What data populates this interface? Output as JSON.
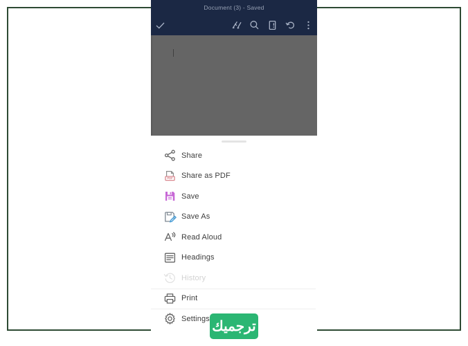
{
  "frame": {
    "border_color": "#2d4a33"
  },
  "titlebar": {
    "title": "Document (3) - Saved",
    "background": "#1b2844",
    "text_color": "#97a1b4"
  },
  "toolbar": {
    "items": [
      {
        "name": "done-check-icon",
        "label": "Done"
      },
      {
        "name": "ink-pen-icon",
        "label": "Ink"
      },
      {
        "name": "search-icon",
        "label": "Search"
      },
      {
        "name": "mobile-view-icon",
        "label": "Mobile view"
      },
      {
        "name": "undo-icon",
        "label": "Undo"
      },
      {
        "name": "overflow-menu-icon",
        "label": "More options"
      }
    ],
    "icon_color": "#a9b3c6"
  },
  "document": {
    "scrim_color": "#656565",
    "caret_visible": true,
    "drag_handle_color": "#e4e4e4"
  },
  "menu": {
    "items": [
      {
        "label": "Share",
        "icon": "share-icon",
        "icon_color": "#636363",
        "disabled": false,
        "divider_above": false
      },
      {
        "label": "Share as PDF",
        "icon": "share-as-pdf-icon",
        "icon_color": "#d08a93",
        "disabled": false,
        "divider_above": false
      },
      {
        "label": "Save",
        "icon": "save-floppy-icon",
        "icon_color": "#c767d6",
        "disabled": false,
        "divider_above": false
      },
      {
        "label": "Save As",
        "icon": "save-as-icon",
        "icon_color": "#7e8892",
        "disabled": false,
        "divider_above": false
      },
      {
        "label": "Read Aloud",
        "icon": "read-aloud-icon",
        "icon_color": "#636363",
        "disabled": false,
        "divider_above": false
      },
      {
        "label": "Headings",
        "icon": "headings-icon",
        "icon_color": "#636363",
        "disabled": false,
        "divider_above": false
      },
      {
        "label": "History",
        "icon": "history-icon",
        "icon_color": "#e2e2e2",
        "disabled": true,
        "divider_above": false
      },
      {
        "label": "Print",
        "icon": "print-icon",
        "icon_color": "#636363",
        "disabled": false,
        "divider_above": true
      },
      {
        "label": "Settings",
        "icon": "gear-icon",
        "icon_color": "#636363",
        "disabled": false,
        "divider_above": true
      }
    ]
  },
  "watermark": {
    "text": "ترجميك",
    "background": "#2bb673",
    "text_color": "#ffffff"
  }
}
